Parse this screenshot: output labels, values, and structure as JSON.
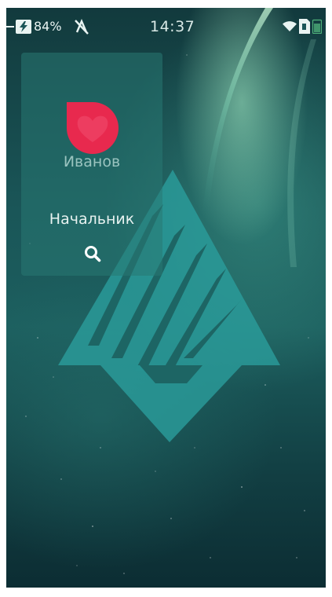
{
  "status_bar": {
    "battery_percent": "84%",
    "time": "14:37",
    "icons": [
      "charging-bolt-icon",
      "no-signal-icon",
      "wifi-icon",
      "sim-card-icon",
      "battery-icon"
    ]
  },
  "cover": {
    "name": "Иванов",
    "role": "Начальник",
    "app_icon": "heart-bubble-icon",
    "action_icon": "search-icon"
  },
  "colors": {
    "background_dark": "#0c2d33",
    "background_teal": "#1c5e5e",
    "logo_teal": "#2fa3a3",
    "app_icon_red": "#e8294e",
    "cover_bg": "#2a7a74"
  }
}
